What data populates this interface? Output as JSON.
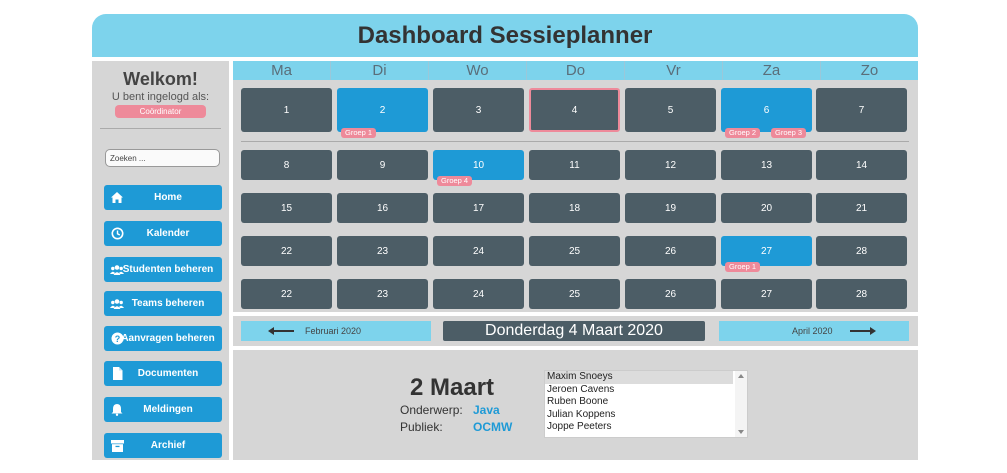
{
  "header": {
    "title": "Dashboard Sessieplanner"
  },
  "sidebar": {
    "welcome": "Welkom!",
    "logged_in_as": "U bent ingelogd als:",
    "role": "Coördinator",
    "search_placeholder": "Zoeken ...",
    "nav": [
      {
        "label": "Home",
        "icon": "home-icon"
      },
      {
        "label": "Kalender",
        "icon": "clock-icon"
      },
      {
        "label": "Studenten beheren",
        "icon": "users-icon"
      },
      {
        "label": "Teams beheren",
        "icon": "users-icon"
      },
      {
        "label": "Aanvragen beheren",
        "icon": "question-icon"
      },
      {
        "label": "Documenten",
        "icon": "document-icon"
      },
      {
        "label": "Meldingen",
        "icon": "bell-icon"
      },
      {
        "label": "Archief",
        "icon": "archive-icon"
      }
    ]
  },
  "calendar": {
    "weekdays": [
      "Ma",
      "Di",
      "Wo",
      "Do",
      "Vr",
      "Za",
      "Zo"
    ],
    "weeks": [
      [
        "1",
        "2",
        "3",
        "4",
        "5",
        "6",
        "7"
      ],
      [
        "8",
        "9",
        "10",
        "11",
        "12",
        "13",
        "14"
      ],
      [
        "15",
        "16",
        "17",
        "18",
        "19",
        "20",
        "21"
      ],
      [
        "22",
        "23",
        "24",
        "25",
        "26",
        "27",
        "28"
      ],
      [
        "22",
        "23",
        "24",
        "25",
        "26",
        "27",
        "28"
      ]
    ],
    "highlighted_days": [
      "2",
      "6",
      "10",
      "27"
    ],
    "today": "4",
    "tags": [
      {
        "day": "2",
        "label": "Groep 1"
      },
      {
        "day": "6",
        "label": "Groep 2"
      },
      {
        "day": "6",
        "label": "Groep 3"
      },
      {
        "day": "10",
        "label": "Groep 4"
      },
      {
        "day": "27",
        "label": "Groep 1"
      }
    ],
    "prev_month": "Februari 2020",
    "next_month": "April 2020",
    "current_date": "Donderdag 4 Maart 2020"
  },
  "detail": {
    "date": "2 Maart",
    "subject_label": "Onderwerp:",
    "subject": "Java",
    "audience_label": "Publiek:",
    "audience": "OCMW",
    "participants": [
      "Maxim Snoeys",
      "Jeroen Cavens",
      "Ruben Boone",
      "Julian Koppens",
      "Joppe Peeters"
    ]
  },
  "colors": {
    "accent": "#7dd3ec",
    "primary": "#1e9ad6",
    "cell": "#4c5d66",
    "tag": "#ee8a9a",
    "panel": "#d6d6d6"
  }
}
